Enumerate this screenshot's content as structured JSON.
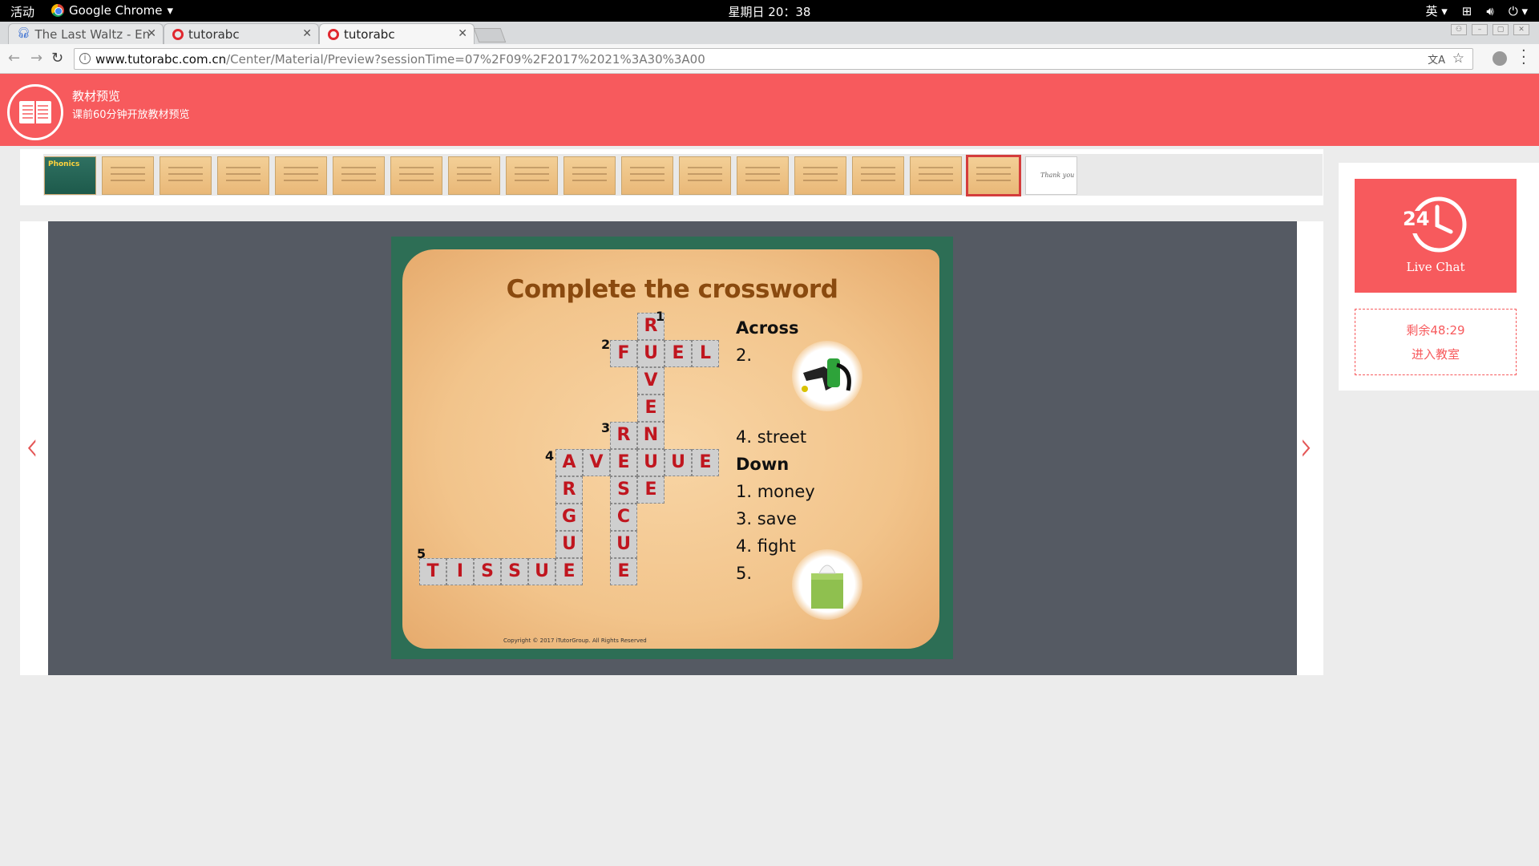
{
  "system_bar": {
    "activities": "活动",
    "app_name": "Google Chrome",
    "clock": "星期日 20：38",
    "input_method": "英"
  },
  "tabs": [
    {
      "title": "The Last Waltz - En",
      "icon": "headphones-icon"
    },
    {
      "title": "tutorabc",
      "icon": "tutorabc-logo-icon"
    },
    {
      "title": "tutorabc",
      "icon": "tutorabc-logo-icon"
    }
  ],
  "address_bar": {
    "host": "www.tutorabc.com.cn",
    "path": "/Center/Material/Preview?sessionTime=07%2F09%2F2017%2021%3A30%3A00"
  },
  "header": {
    "title": "教材预览",
    "subtitle": "课前60分钟开放教材预览",
    "icon": "open-book-icon"
  },
  "thumbnails": {
    "count": 18,
    "active_index": 16,
    "first_label": "Phonics",
    "last_label": "Thank you"
  },
  "slide": {
    "title": "Complete the crossword",
    "across_heading": "Across",
    "down_heading": "Down",
    "clue_across_2": "2.",
    "clue_across_4": "4. street",
    "clue_down_1": "1. money",
    "clue_down_3": "3. save",
    "clue_down_4": "4. fight",
    "clue_down_5": "5.",
    "copyright": "Copyright © 2017 iTutorGroup. All Rights Reserved",
    "numbers": [
      "1",
      "2",
      "3",
      "4",
      "5"
    ],
    "words": {
      "fuel": "FUEL",
      "revenue": "REVENUE",
      "avenue": "AVENUE",
      "rescue": "RESCUE",
      "argue": "ARGUE",
      "tissue": "TISSUE"
    }
  },
  "live_chat": {
    "badge": "24",
    "label": "Live Chat"
  },
  "classroom": {
    "remaining": "剩余48:29",
    "enter": "进入教室"
  }
}
